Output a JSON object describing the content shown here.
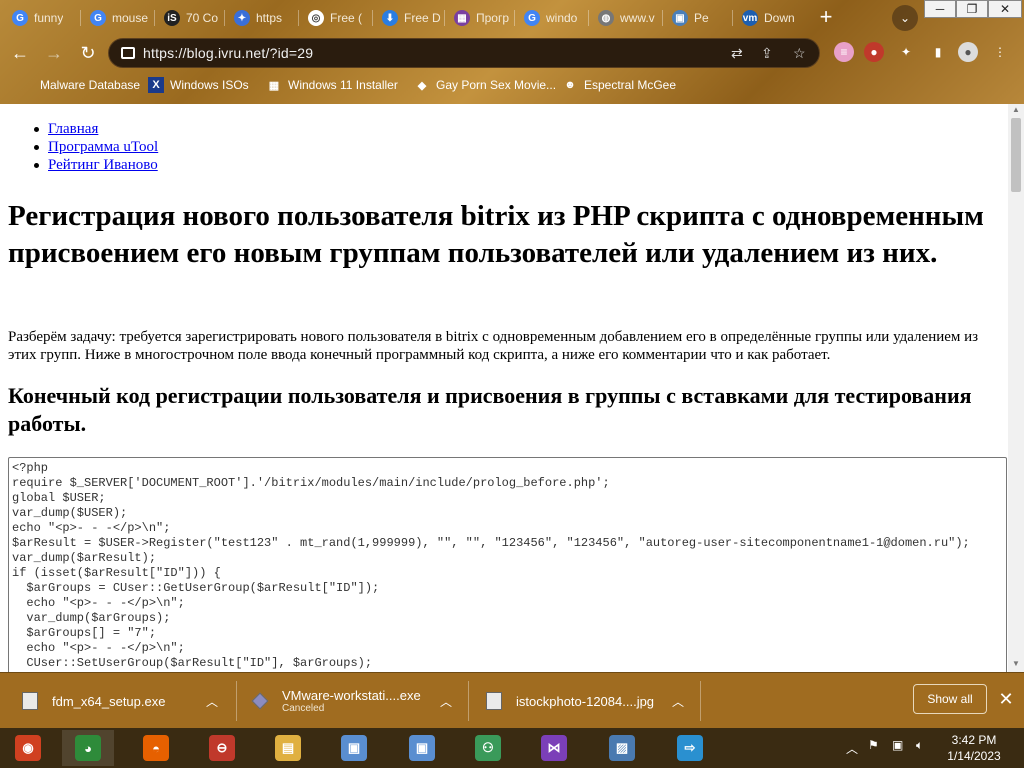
{
  "browser": {
    "tabs": [
      {
        "label": "funny",
        "icon": "google-icon",
        "color": "#4285f4",
        "glyph": "G"
      },
      {
        "label": "mouse",
        "icon": "google-icon",
        "color": "#4285f4",
        "glyph": "G"
      },
      {
        "label": "70 Co",
        "icon": "istock-icon",
        "color": "#222222",
        "glyph": "iS"
      },
      {
        "label": "https",
        "icon": "puzzle-icon",
        "color": "#3a6fd8",
        "glyph": "✦"
      },
      {
        "label": "Free (",
        "icon": "circle-icon",
        "color": "#ffffff",
        "glyph": "◎"
      },
      {
        "label": "Free D",
        "icon": "fdm-icon",
        "color": "#2a7de1",
        "glyph": "⬇"
      },
      {
        "label": "Прогр",
        "icon": "utool-icon",
        "color": "#7a3fa0",
        "glyph": "▦"
      },
      {
        "label": "windo",
        "icon": "google-icon",
        "color": "#4285f4",
        "glyph": "G"
      },
      {
        "label": "www.v",
        "icon": "globe-icon",
        "color": "#777777",
        "glyph": "◍"
      },
      {
        "label": "Pe",
        "icon": "page-icon",
        "color": "#4b7fb8",
        "glyph": "▣"
      },
      {
        "label": "Down",
        "icon": "vmware-icon",
        "color": "#1d5fb0",
        "glyph": "vm"
      }
    ],
    "url": "https://blog.ivru.net/?id=29",
    "bookmarks": [
      {
        "label": "Malware Database",
        "icon": "bookmark-icon",
        "glyph": ""
      },
      {
        "label": "Windows ISOs",
        "icon": "x-icon",
        "glyph": "X"
      },
      {
        "label": "Windows 11 Installer",
        "icon": "image-icon",
        "glyph": "▦"
      },
      {
        "label": "Gay Porn Sex Movie...",
        "icon": "site-icon",
        "glyph": "◆"
      },
      {
        "label": "Espectral McGee",
        "icon": "avatar-icon",
        "glyph": "☻"
      }
    ]
  },
  "page": {
    "nav": [
      {
        "label": "Главная"
      },
      {
        "label": "Программа uTool"
      },
      {
        "label": "Рейтинг Иваново"
      }
    ],
    "title": "Регистрация нового пользователя bitrix из PHP скрипта с одновременным присвоением его новым группам пользователей или удалением из них.",
    "intro": "Разберём задачу: требуется зарегистрировать нового пользователя в bitrix с одновременным добавлением его в определённые группы или удалением из этих групп. Ниже в многострочном поле ввода конечный программный код скрипта, а ниже его комментарии что и как работает.",
    "subtitle": "Конечный код регистрации пользователя и присвоения в группы с вставками для тестирования работы.",
    "code_lines": [
      "<?php",
      "require $_SERVER['DOCUMENT_ROOT'].'/bitrix/modules/main/include/prolog_before.php';",
      "global $USER;",
      "var_dump($USER);",
      "echo \"<p>- - -</p>\\n\";",
      "$arResult = $USER->Register(\"test123\" . mt_rand(1,999999), \"\", \"\", \"123456\", \"123456\", \"autoreg-user-sitecomponentname1-1@domen.ru\");",
      "var_dump($arResult);",
      "if (isset($arResult[\"ID\"])) {",
      "  $arGroups = CUser::GetUserGroup($arResult[\"ID\"]);",
      "  echo \"<p>- - -</p>\\n\";",
      "  var_dump($arGroups);",
      "  $arGroups[] = \"7\";",
      "  echo \"<p>- - -</p>\\n\";",
      "  CUser::SetUserGroup($arResult[\"ID\"], $arGroups);"
    ]
  },
  "downloads": {
    "items": [
      {
        "name": "fdm_x64_setup.exe",
        "status": ""
      },
      {
        "name": "VMware-workstati....exe",
        "status": "Canceled"
      },
      {
        "name": "istockphoto-12084....jpg",
        "status": ""
      }
    ],
    "show_all": "Show all"
  },
  "taskbar": {
    "apps": [
      {
        "name": "app-1",
        "color": "#d04020",
        "glyph": "◉"
      },
      {
        "name": "chrome",
        "color": "#2e8b3a",
        "glyph": "◕"
      },
      {
        "name": "firefox",
        "color": "#e66000",
        "glyph": "◓"
      },
      {
        "name": "app-4",
        "color": "#c0392b",
        "glyph": "⊖"
      },
      {
        "name": "file-explorer",
        "color": "#e0b040",
        "glyph": "▤"
      },
      {
        "name": "setup-1",
        "color": "#5a8ed0",
        "glyph": "▣"
      },
      {
        "name": "setup-2",
        "color": "#5a8ed0",
        "glyph": "▣"
      },
      {
        "name": "network",
        "color": "#3a9a5a",
        "glyph": "⚇"
      },
      {
        "name": "visual-studio",
        "color": "#7b3fb8",
        "glyph": "⋈"
      },
      {
        "name": "photos",
        "color": "#4a7ab0",
        "glyph": "▨"
      },
      {
        "name": "app-11",
        "color": "#2a90d0",
        "glyph": "⇨"
      }
    ],
    "time": "3:42 PM",
    "date": "1/14/2023"
  }
}
